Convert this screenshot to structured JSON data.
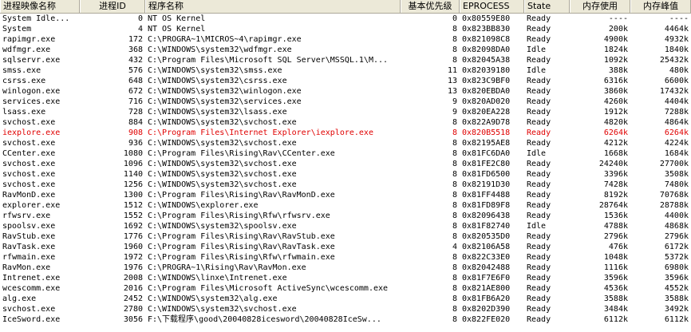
{
  "columns": [
    {
      "key": "name",
      "label": "进程映像名称",
      "align": "left"
    },
    {
      "key": "pid",
      "label": "进程ID",
      "align": "right"
    },
    {
      "key": "path",
      "label": "程序名称",
      "align": "left"
    },
    {
      "key": "prio",
      "label": "基本优先级",
      "align": "right"
    },
    {
      "key": "eprocess",
      "label": "EPROCESS",
      "align": "left"
    },
    {
      "key": "state",
      "label": "State",
      "align": "left"
    },
    {
      "key": "mem",
      "label": "内存使用",
      "align": "right"
    },
    {
      "key": "peak",
      "label": "内存峰值",
      "align": "right"
    }
  ],
  "selected_index": 11,
  "rows": [
    {
      "name": "System Idle...",
      "pid": "0",
      "path": "NT OS Kernel",
      "prio": "0",
      "eprocess": "0x80559E80",
      "state": "Ready",
      "mem": "----",
      "peak": "----"
    },
    {
      "name": "System",
      "pid": "4",
      "path": "NT OS Kernel",
      "prio": "8",
      "eprocess": "0x823BB830",
      "state": "Ready",
      "mem": "200k",
      "peak": "4464k"
    },
    {
      "name": "rapimgr.exe",
      "pid": "172",
      "path": "C:\\PROGRA~1\\MICROS~4\\rapimgr.exe",
      "prio": "8",
      "eprocess": "0x821098C8",
      "state": "Ready",
      "mem": "4900k",
      "peak": "4932k"
    },
    {
      "name": "wdfmgr.exe",
      "pid": "368",
      "path": "C:\\WINDOWS\\system32\\wdfmgr.exe",
      "prio": "8",
      "eprocess": "0x82098DA0",
      "state": "Idle",
      "mem": "1824k",
      "peak": "1840k"
    },
    {
      "name": "sqlservr.exe",
      "pid": "432",
      "path": "C:\\Program Files\\Microsoft SQL Server\\MSSQL.1\\M...",
      "prio": "8",
      "eprocess": "0x82045A38",
      "state": "Ready",
      "mem": "1092k",
      "peak": "25432k"
    },
    {
      "name": "smss.exe",
      "pid": "576",
      "path": "C:\\WINDOWS\\system32\\smss.exe",
      "prio": "11",
      "eprocess": "0x82039180",
      "state": "Idle",
      "mem": "388k",
      "peak": "480k"
    },
    {
      "name": "csrss.exe",
      "pid": "648",
      "path": "C:\\WINDOWS\\system32\\csrss.exe",
      "prio": "13",
      "eprocess": "0x823C9BF0",
      "state": "Ready",
      "mem": "6316k",
      "peak": "6600k"
    },
    {
      "name": "winlogon.exe",
      "pid": "672",
      "path": "C:\\WINDOWS\\system32\\winlogon.exe",
      "prio": "13",
      "eprocess": "0x820EBDA0",
      "state": "Ready",
      "mem": "3860k",
      "peak": "17432k"
    },
    {
      "name": "services.exe",
      "pid": "716",
      "path": "C:\\WINDOWS\\system32\\services.exe",
      "prio": "9",
      "eprocess": "0x820AD020",
      "state": "Ready",
      "mem": "4260k",
      "peak": "4404k"
    },
    {
      "name": "lsass.exe",
      "pid": "728",
      "path": "C:\\WINDOWS\\system32\\lsass.exe",
      "prio": "9",
      "eprocess": "0x820EA228",
      "state": "Ready",
      "mem": "1912k",
      "peak": "7288k"
    },
    {
      "name": "svchost.exe",
      "pid": "884",
      "path": "C:\\WINDOWS\\system32\\svchost.exe",
      "prio": "8",
      "eprocess": "0x822A9D78",
      "state": "Ready",
      "mem": "4820k",
      "peak": "4864k"
    },
    {
      "name": "iexplore.exe",
      "pid": "908",
      "path": "C:\\Program Files\\Internet Explorer\\iexplore.exe",
      "prio": "8",
      "eprocess": "0x820B5518",
      "state": "Ready",
      "mem": "6264k",
      "peak": "6264k"
    },
    {
      "name": "svchost.exe",
      "pid": "936",
      "path": "C:\\WINDOWS\\system32\\svchost.exe",
      "prio": "8",
      "eprocess": "0x82195AE8",
      "state": "Ready",
      "mem": "4212k",
      "peak": "4224k"
    },
    {
      "name": "CCenter.exe",
      "pid": "1080",
      "path": "C:\\Program Files\\Rising\\Rav\\CCenter.exe",
      "prio": "8",
      "eprocess": "0x81FC6DA0",
      "state": "Idle",
      "mem": "1668k",
      "peak": "1684k"
    },
    {
      "name": "svchost.exe",
      "pid": "1096",
      "path": "C:\\WINDOWS\\system32\\svchost.exe",
      "prio": "8",
      "eprocess": "0x81FE2C80",
      "state": "Ready",
      "mem": "24240k",
      "peak": "27700k"
    },
    {
      "name": "svchost.exe",
      "pid": "1140",
      "path": "C:\\WINDOWS\\system32\\svchost.exe",
      "prio": "8",
      "eprocess": "0x81FD6500",
      "state": "Ready",
      "mem": "3396k",
      "peak": "3508k"
    },
    {
      "name": "svchost.exe",
      "pid": "1256",
      "path": "C:\\WINDOWS\\system32\\svchost.exe",
      "prio": "8",
      "eprocess": "0x82191D30",
      "state": "Ready",
      "mem": "7428k",
      "peak": "7480k"
    },
    {
      "name": "RavMonD.exe",
      "pid": "1300",
      "path": "C:\\Program Files\\Rising\\Rav\\RavMonD.exe",
      "prio": "8",
      "eprocess": "0x81FF4488",
      "state": "Ready",
      "mem": "8192k",
      "peak": "70768k"
    },
    {
      "name": "explorer.exe",
      "pid": "1512",
      "path": "C:\\WINDOWS\\explorer.exe",
      "prio": "8",
      "eprocess": "0x81FD89F8",
      "state": "Ready",
      "mem": "28764k",
      "peak": "28788k"
    },
    {
      "name": "rfwsrv.exe",
      "pid": "1552",
      "path": "C:\\Program Files\\Rising\\Rfw\\rfwsrv.exe",
      "prio": "8",
      "eprocess": "0x82096438",
      "state": "Ready",
      "mem": "1536k",
      "peak": "4400k"
    },
    {
      "name": "spoolsv.exe",
      "pid": "1692",
      "path": "C:\\WINDOWS\\system32\\spoolsv.exe",
      "prio": "8",
      "eprocess": "0x81F82740",
      "state": "Idle",
      "mem": "4788k",
      "peak": "4868k"
    },
    {
      "name": "RavStub.exe",
      "pid": "1776",
      "path": "C:\\Program Files\\Rising\\Rav\\RavStub.exe",
      "prio": "8",
      "eprocess": "0x820535D0",
      "state": "Ready",
      "mem": "2796k",
      "peak": "2796k"
    },
    {
      "name": "RavTask.exe",
      "pid": "1960",
      "path": "C:\\Program Files\\Rising\\Rav\\RavTask.exe",
      "prio": "4",
      "eprocess": "0x82106A58",
      "state": "Ready",
      "mem": "476k",
      "peak": "6172k"
    },
    {
      "name": "rfwmain.exe",
      "pid": "1972",
      "path": "C:\\Program Files\\Rising\\Rfw\\rfwmain.exe",
      "prio": "8",
      "eprocess": "0x822C33E0",
      "state": "Ready",
      "mem": "1048k",
      "peak": "5372k"
    },
    {
      "name": "RavMon.exe",
      "pid": "1976",
      "path": "C:\\PROGRA~1\\Rising\\Rav\\RavMon.exe",
      "prio": "8",
      "eprocess": "0x82042488",
      "state": "Ready",
      "mem": "1116k",
      "peak": "6980k"
    },
    {
      "name": "Intrenet.exe",
      "pid": "2008",
      "path": "C:\\WINDOWS\\linxe\\Intrenet.exe",
      "prio": "8",
      "eprocess": "0x81F7E6F0",
      "state": "Ready",
      "mem": "3596k",
      "peak": "3596k"
    },
    {
      "name": "wcescomm.exe",
      "pid": "2016",
      "path": "C:\\Program Files\\Microsoft ActiveSync\\wcescomm.exe",
      "prio": "8",
      "eprocess": "0x821AE800",
      "state": "Ready",
      "mem": "4536k",
      "peak": "4552k"
    },
    {
      "name": "alg.exe",
      "pid": "2452",
      "path": "C:\\WINDOWS\\system32\\alg.exe",
      "prio": "8",
      "eprocess": "0x81FB6A20",
      "state": "Ready",
      "mem": "3588k",
      "peak": "3588k"
    },
    {
      "name": "svchost.exe",
      "pid": "2780",
      "path": "C:\\WINDOWS\\system32\\svchost.exe",
      "prio": "8",
      "eprocess": "0x8202D390",
      "state": "Ready",
      "mem": "3484k",
      "peak": "3492k"
    },
    {
      "name": "IceSword.exe",
      "pid": "3056",
      "path": "F:\\下载程序\\good\\20040828icesword\\20040828IceSw...",
      "prio": "8",
      "eprocess": "0x822FE020",
      "state": "Ready",
      "mem": "6112k",
      "peak": "6112k"
    }
  ]
}
